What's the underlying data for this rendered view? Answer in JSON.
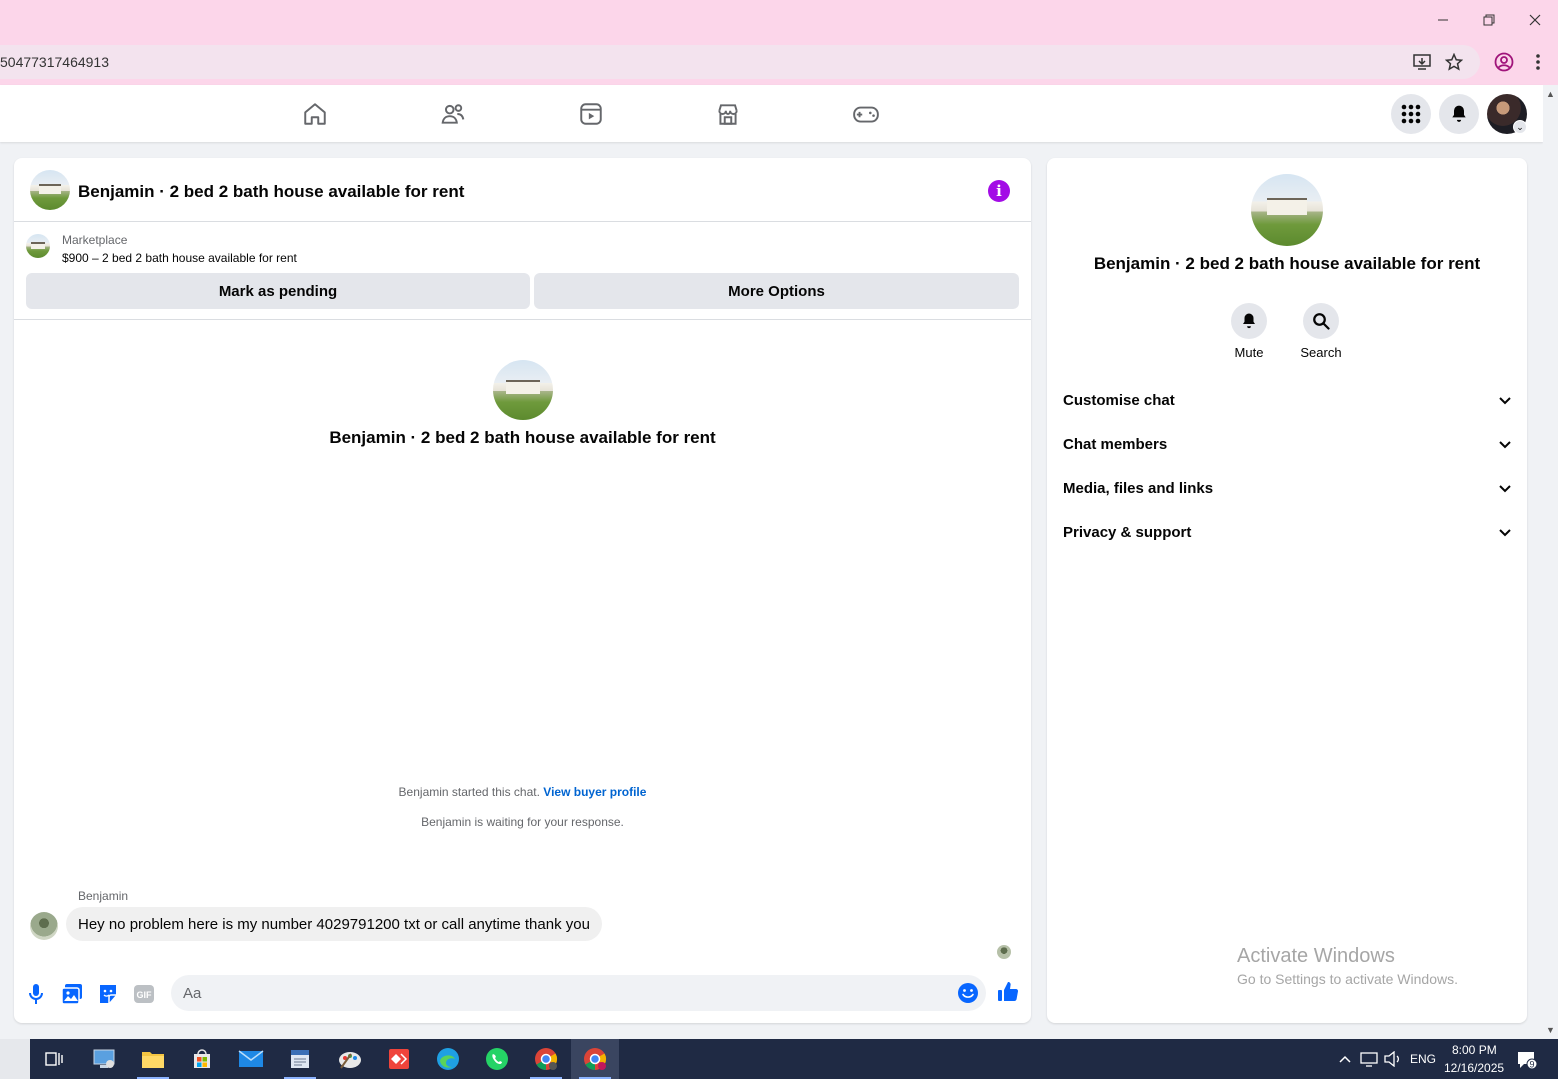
{
  "browser": {
    "url_fragment": "50477317464913",
    "window_controls": [
      "minimize",
      "restore",
      "close"
    ]
  },
  "chat": {
    "title": "Benjamin · 2 bed 2 bath house available for rent",
    "marketplace_label": "Marketplace",
    "listing_text": "$900 – 2 bed 2 bath house available for rent",
    "mark_pending_label": "Mark as pending",
    "more_options_label": "More Options",
    "center_title": "Benjamin · 2 bed 2 bath house available for rent",
    "started_text": "Benjamin started this chat.",
    "view_buyer_link": "View buyer profile",
    "waiting_text": "Benjamin is waiting for your response.",
    "sender_name": "Benjamin",
    "message": "Hey no problem here is my number 4029791200 txt or call anytime thank you",
    "composer_placeholder": "Aa",
    "accent_color": "#0866ff",
    "info_color": "#a30ce6"
  },
  "info_panel": {
    "title": "Benjamin · 2 bed 2 bath house available for rent",
    "actions": [
      {
        "label": "Mute",
        "icon": "bell-icon"
      },
      {
        "label": "Search",
        "icon": "search-icon"
      }
    ],
    "sections": [
      {
        "label": "Customise chat"
      },
      {
        "label": "Chat members"
      },
      {
        "label": "Media, files and links"
      },
      {
        "label": "Privacy & support"
      }
    ],
    "watermark_title": "Activate Windows",
    "watermark_sub": "Go to Settings to activate Windows."
  },
  "taskbar": {
    "language": "ENG",
    "time": "8:00 PM",
    "date": "12/16/2025",
    "notification_count": "9"
  }
}
